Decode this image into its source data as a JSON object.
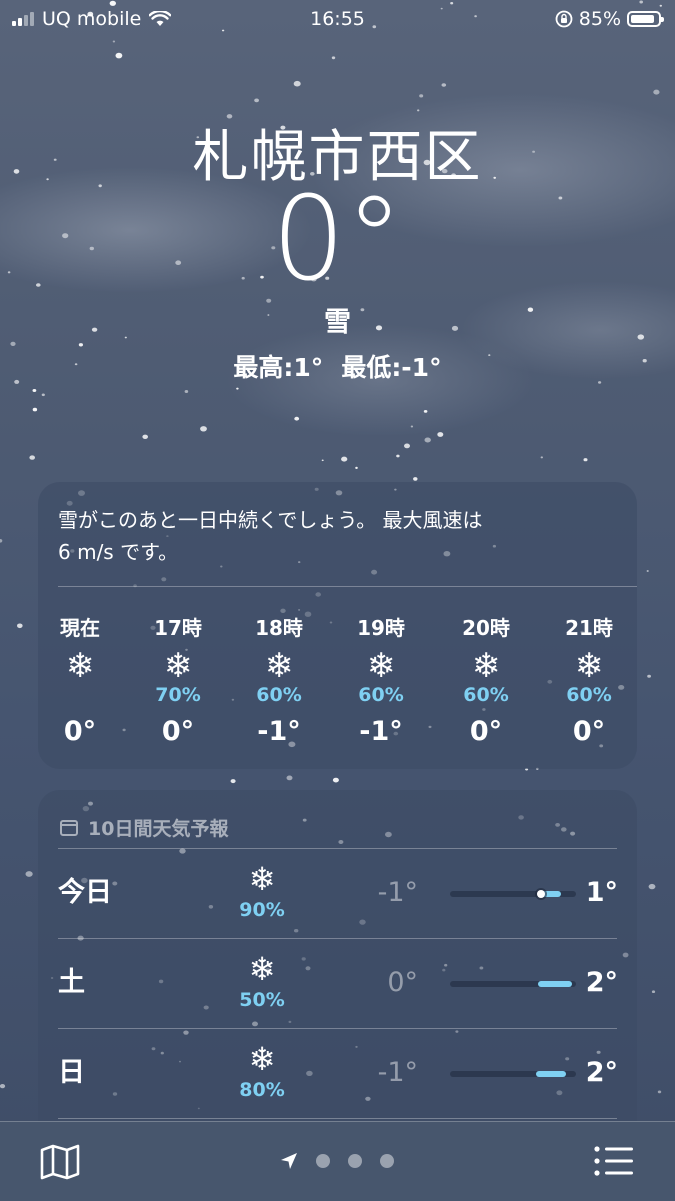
{
  "status_bar": {
    "carrier": "UQ mobile",
    "time": "16:55",
    "battery": "85%"
  },
  "location": {
    "city": "札幌市西区",
    "temperature": "0°",
    "condition": "雪",
    "high": "最高:1°",
    "low": "最低:-1°"
  },
  "hourly": {
    "summary_line1": "雪がこのあと一日中続くでしょう。 最大風速は",
    "summary_line2": "6 m/s です。",
    "items": [
      {
        "label": "現在",
        "icon": "snowflake-icon",
        "glyph": "❄",
        "prob": "",
        "temp": "0°"
      },
      {
        "label": "17時",
        "icon": "snowflake-icon",
        "glyph": "❄",
        "prob": "70%",
        "temp": "0°"
      },
      {
        "label": "18時",
        "icon": "snowflake-icon",
        "glyph": "❄",
        "prob": "60%",
        "temp": "-1°"
      },
      {
        "label": "19時",
        "icon": "snowflake-icon",
        "glyph": "❄",
        "prob": "60%",
        "temp": "-1°"
      },
      {
        "label": "20時",
        "icon": "snowflake-icon",
        "glyph": "❄",
        "prob": "60%",
        "temp": "0°"
      },
      {
        "label": "21時",
        "icon": "snowflake-icon",
        "glyph": "❄",
        "prob": "60%",
        "temp": "0°"
      }
    ]
  },
  "daily": {
    "title": "10日間天気予報",
    "rows": [
      {
        "day": "今日",
        "glyph": "❄",
        "prob": "90%",
        "low": "-1°",
        "high": "1°",
        "range_start": 0.72,
        "range_end": 0.88,
        "current": 0.72
      },
      {
        "day": "土",
        "glyph": "❄",
        "prob": "50%",
        "low": "0°",
        "high": "2°",
        "range_start": 0.7,
        "range_end": 0.97,
        "current": null
      },
      {
        "day": "日",
        "glyph": "❄",
        "prob": "80%",
        "low": "-1°",
        "high": "2°",
        "range_start": 0.68,
        "range_end": 0.92,
        "current": null
      }
    ]
  },
  "colors": {
    "precip_blue": "#7fd0f2",
    "background": "#4f5c73"
  },
  "bottom_bar": {
    "left_icon": "map-icon",
    "center_icons": [
      "location-arrow-icon",
      "page-dot",
      "page-dot",
      "page-dot"
    ],
    "right_icon": "list-icon"
  }
}
